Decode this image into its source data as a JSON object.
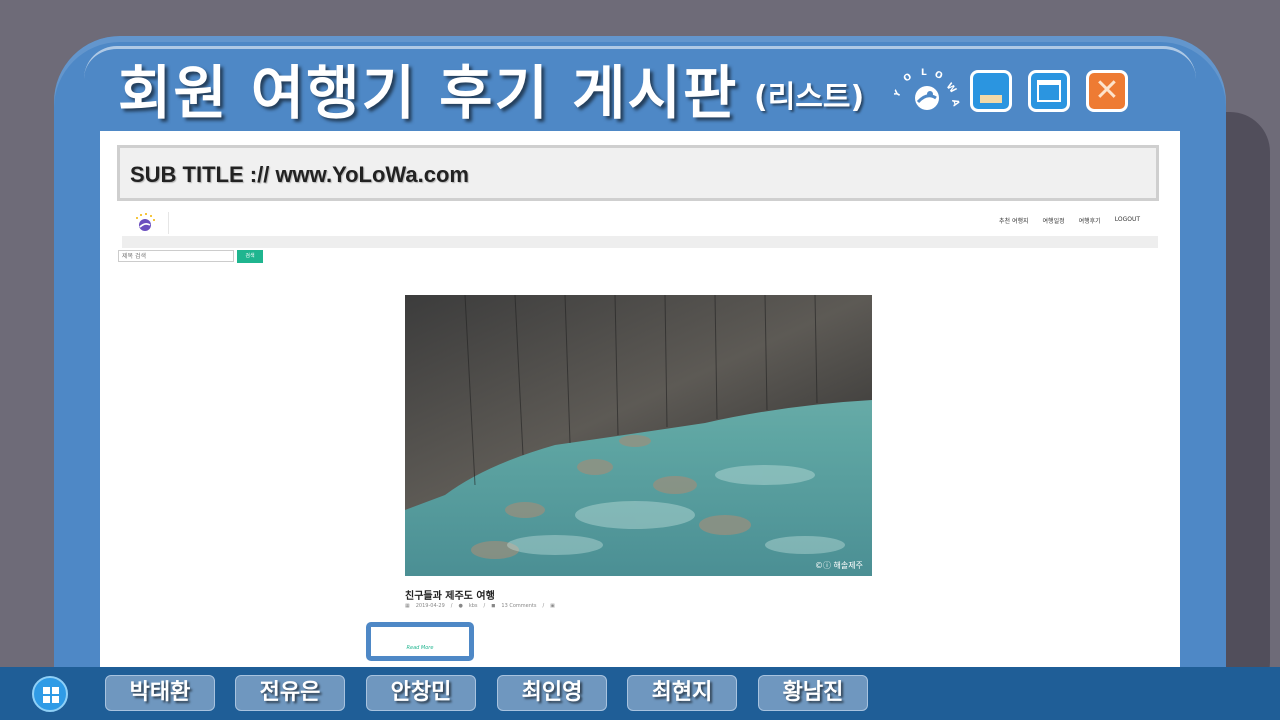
{
  "window": {
    "title": "회원 여행기 후기 게시판",
    "title_suffix": "(리스트)",
    "logo_text": "YOLOWA",
    "colors": {
      "frame": "#4e88c6",
      "minimize": "#2b95e0",
      "maximize": "#2b95e0",
      "close": "#ee7b33"
    }
  },
  "subtitle": "SUB TITLE :// www.YoLoWa.com",
  "site": {
    "nav": [
      "추천 여행지",
      "여행일정",
      "여행후기",
      "LOGOUT"
    ],
    "search": {
      "placeholder": "제목 검색",
      "button": "검색"
    },
    "post": {
      "title": "친구들과 제주도 여행",
      "date": "2019-04-29",
      "author": "kbs",
      "comments": "13 Comments",
      "image_caption": "©ⓘ 해솔제주",
      "read_more": "Read More"
    },
    "accent": "#1fb58f"
  },
  "taskbar": {
    "start_icon": "windows-icon",
    "members": [
      "박태환",
      "전유은",
      "안창민",
      "최인영",
      "최현지",
      "황남진"
    ]
  }
}
